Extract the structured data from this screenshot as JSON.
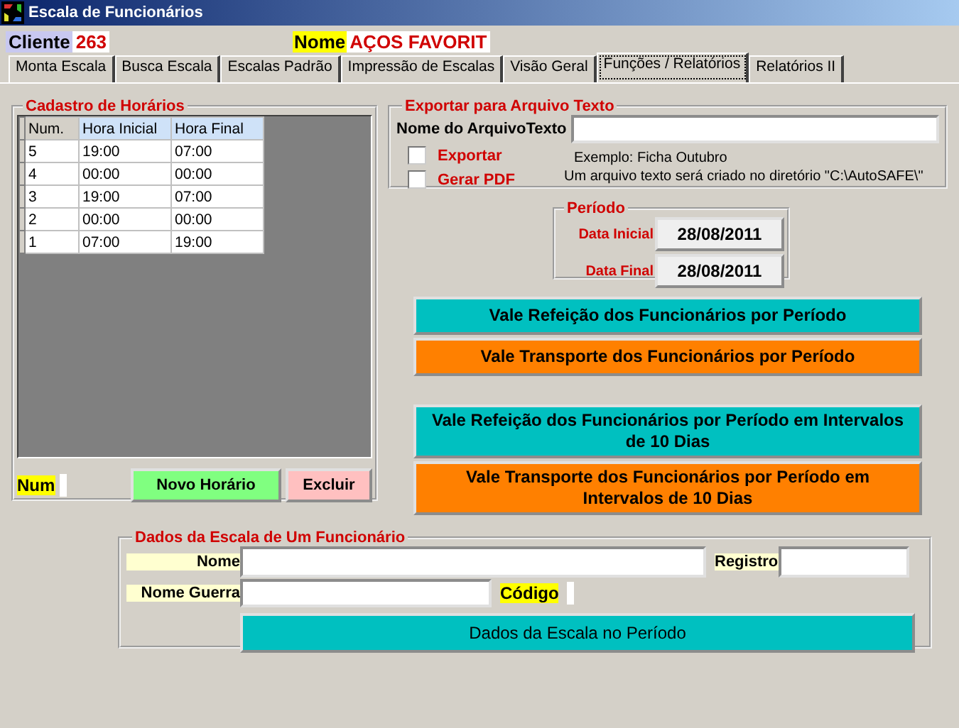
{
  "window": {
    "title": "Escala de Funcionários"
  },
  "header": {
    "cliente_label": "Cliente",
    "cliente_value": "263",
    "nome_label": "Nome",
    "nome_value": "AÇOS FAVORIT"
  },
  "tabs": [
    {
      "label": "Monta Escala",
      "selected": false
    },
    {
      "label": "Busca Escala",
      "selected": false
    },
    {
      "label": "Escalas Padrão",
      "selected": false
    },
    {
      "label": "Impressão de Escalas",
      "selected": false
    },
    {
      "label": "Visão Geral",
      "selected": false
    },
    {
      "label": "Funções / Relatórios",
      "selected": true
    },
    {
      "label": "Relatórios II",
      "selected": false
    }
  ],
  "horarios": {
    "title": "Cadastro de Horários",
    "columns": [
      "Num.",
      "Hora Inicial",
      "Hora Final"
    ],
    "rows": [
      [
        "5",
        "19:00",
        "07:00"
      ],
      [
        "4",
        "00:00",
        "00:00"
      ],
      [
        "3",
        "19:00",
        "07:00"
      ],
      [
        "2",
        "00:00",
        "00:00"
      ],
      [
        "1",
        "07:00",
        "19:00"
      ]
    ],
    "num_label": "Num",
    "buttons": [
      {
        "label": "Novo Horário",
        "color": "#80ff80"
      },
      {
        "label": "Excluir",
        "color": "#ffc0c0"
      }
    ]
  },
  "exportar": {
    "title": "Exportar para Arquivo Texto",
    "file_label": "Nome do ArquivoTexto",
    "options": [
      {
        "label": "Exportar",
        "checked": false
      },
      {
        "label": "Gerar PDF",
        "checked": false
      }
    ],
    "example": "Exemplo: Ficha Outubro",
    "info": "Um arquivo texto será criado no diretório \"C:\\AutoSAFE\\\""
  },
  "periodo": {
    "title": "Período",
    "fields": [
      {
        "label": "Data Inicial",
        "value": "28/08/2011"
      },
      {
        "label": "Data Final",
        "value": "28/08/2011"
      }
    ]
  },
  "report_groups": [
    [
      {
        "label": "Vale Refeição dos Funcionários por Período",
        "color": "#00c0c0"
      },
      {
        "label": "Vale Transporte dos Funcionários por Período",
        "color": "#ff8000"
      }
    ],
    [
      {
        "label": "Vale Refeição dos Funcionários por Período em Intervalos de 10 Dias",
        "color": "#00c0c0"
      },
      {
        "label": "Vale Transporte dos Funcionários por Período em Intervalos de 10 Dias",
        "color": "#ff8000"
      }
    ]
  ],
  "funcionario": {
    "title": "Dados da Escala de Um Funcionário",
    "nome_label": "Nome",
    "registro_label": "Registro",
    "guerra_label": "Nome Guerra",
    "codigo_label": "Código",
    "button": "Dados da Escala no Período"
  }
}
